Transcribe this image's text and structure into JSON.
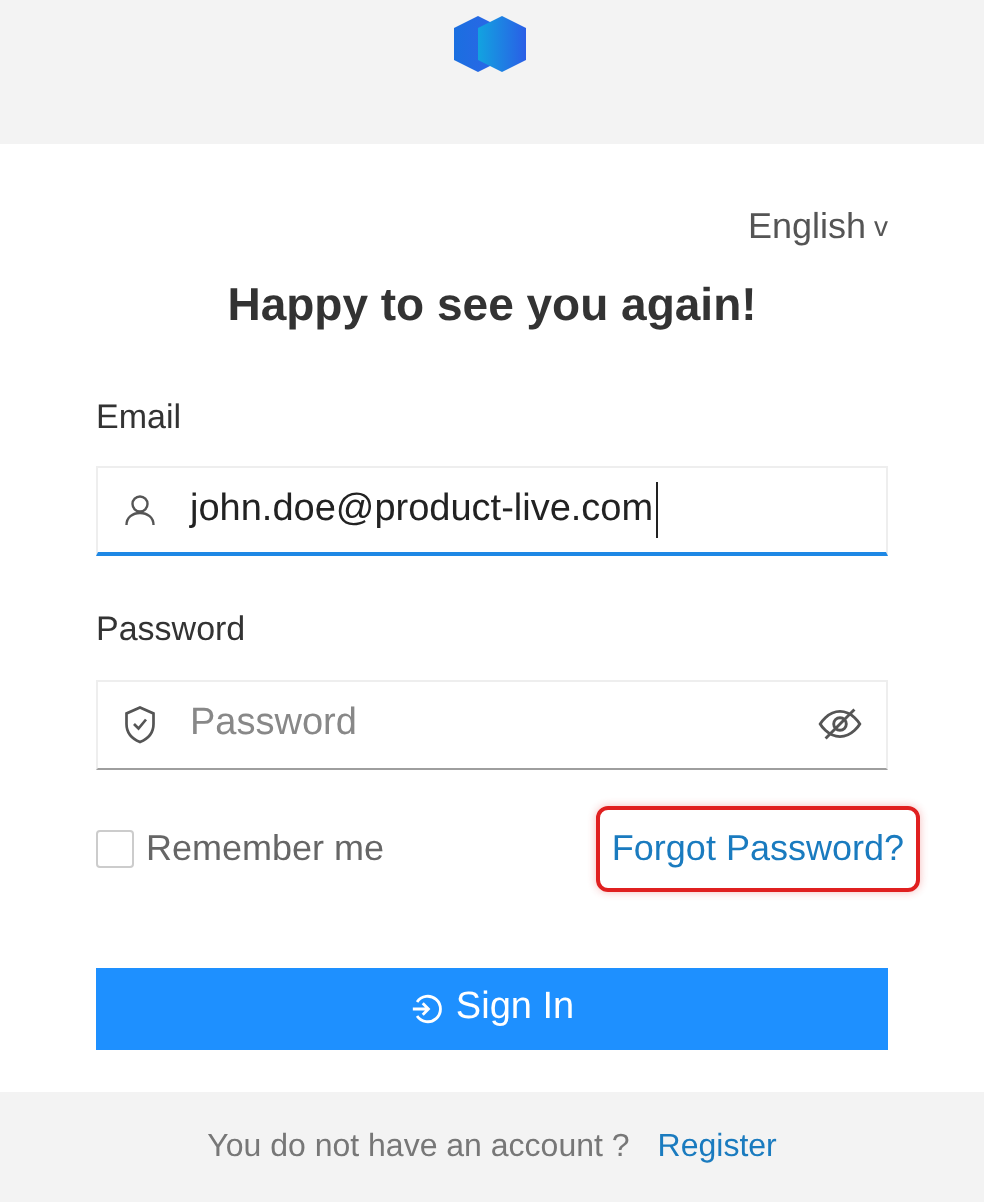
{
  "language": {
    "label": "English",
    "caret": "v"
  },
  "title": "Happy to see you again!",
  "email": {
    "label": "Email",
    "value": "john.doe@product-live.com",
    "focused": true
  },
  "password": {
    "label": "Password",
    "placeholder": "Password",
    "focused": false
  },
  "remember": {
    "label": "Remember me",
    "checked": false
  },
  "forgot": {
    "label": "Forgot Password?",
    "highlighted": true
  },
  "sign_in": {
    "label": "Sign In"
  },
  "footer": {
    "text": "You do not have an account ?",
    "link": "Register"
  }
}
